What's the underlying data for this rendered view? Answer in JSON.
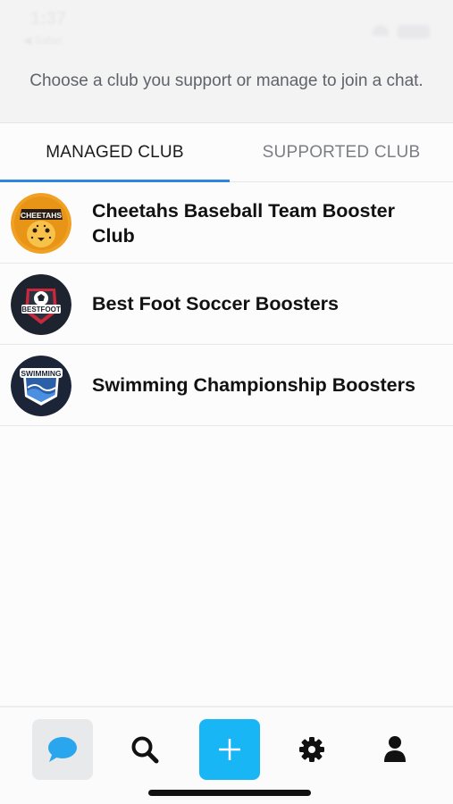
{
  "status_bar": {
    "time": "1:37",
    "back_label": "◀ Safari"
  },
  "header": {
    "subtitle": "Choose a club you support or manage to join a chat."
  },
  "tabs": [
    {
      "label": "MANAGED CLUB",
      "selected": true
    },
    {
      "label": "SUPPORTED CLUB",
      "selected": false
    }
  ],
  "clubs": [
    {
      "name": "Cheetahs Baseball Team Booster Club",
      "logo": "cheetahs-logo",
      "logo_text": "CHEETAHS"
    },
    {
      "name": "Best Foot Soccer Boosters",
      "logo": "bestfoot-logo",
      "logo_text": "BESTFOOT"
    },
    {
      "name": "Swimming Championship Boosters",
      "logo": "swimming-logo",
      "logo_text": "SWIMMING"
    }
  ],
  "bottom_nav": [
    {
      "name": "chats",
      "icon": "chat-bubble-icon",
      "active": true
    },
    {
      "name": "search",
      "icon": "search-icon",
      "active": false
    },
    {
      "name": "add",
      "icon": "plus-icon",
      "active": false
    },
    {
      "name": "settings",
      "icon": "gear-icon",
      "active": false
    },
    {
      "name": "profile",
      "icon": "person-icon",
      "active": false
    }
  ],
  "colors": {
    "accent": "#2e86de",
    "add_button": "#19b6f5",
    "chat_icon": "#2aa6ee"
  }
}
